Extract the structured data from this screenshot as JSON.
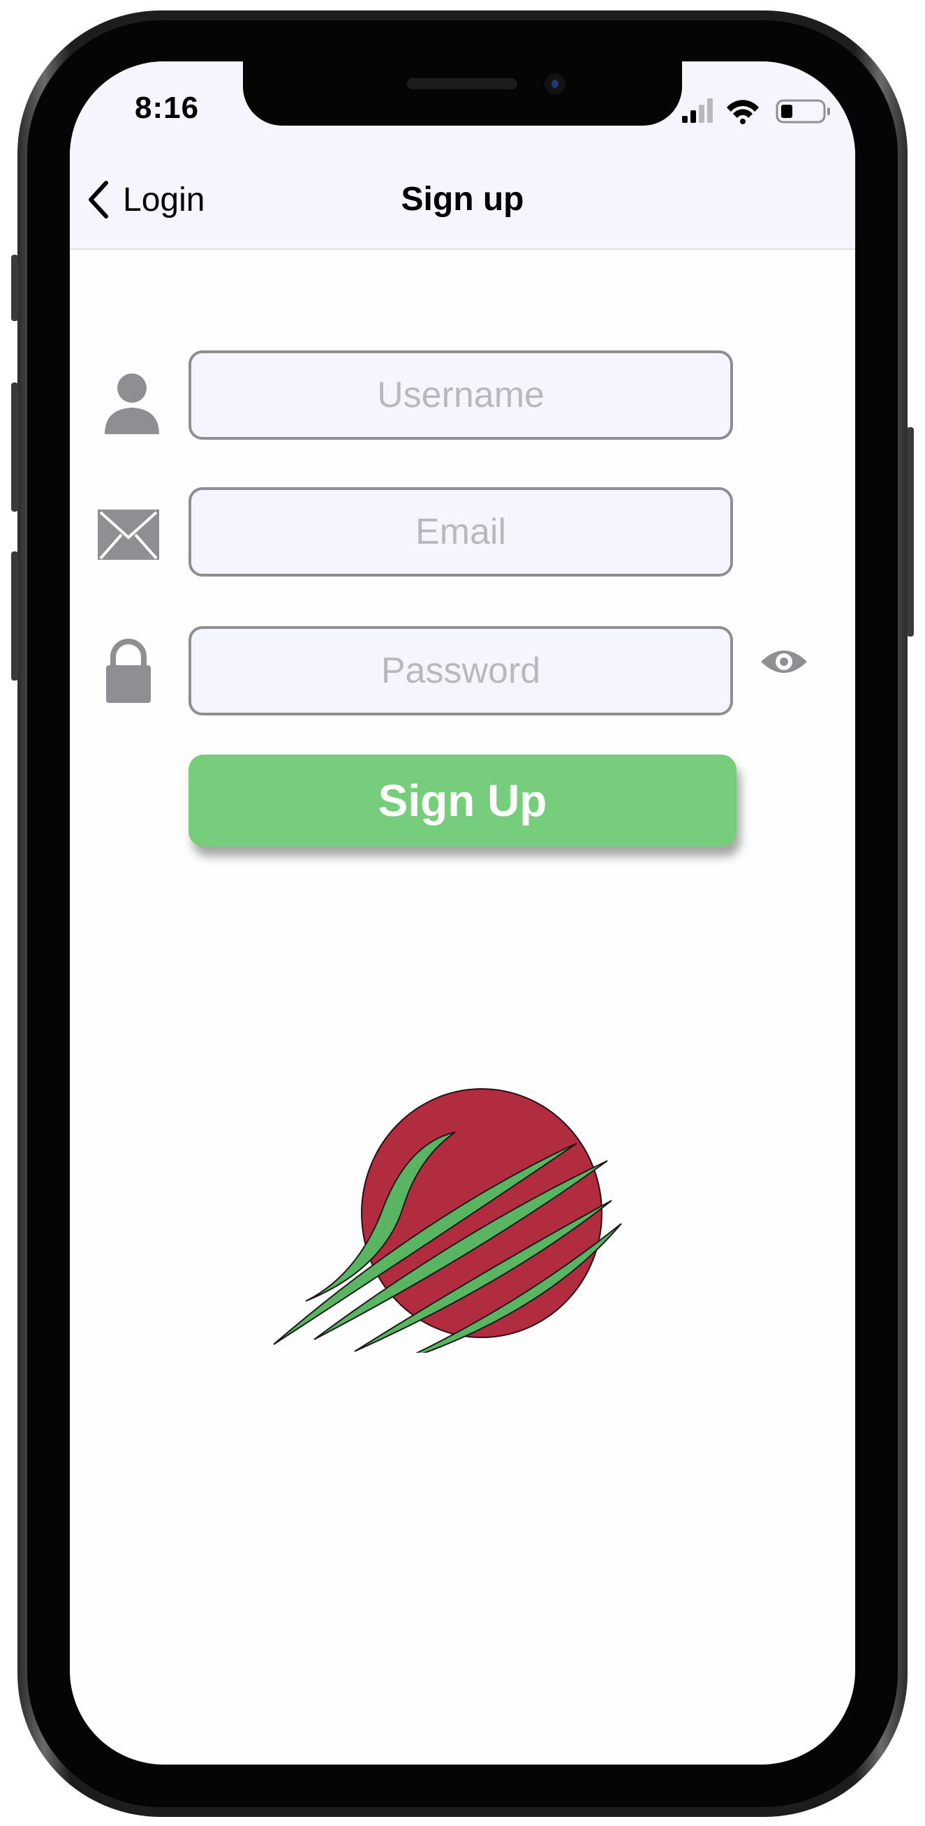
{
  "status_bar": {
    "time": "8:16"
  },
  "nav": {
    "back_label": "Login",
    "title": "Sign up"
  },
  "form": {
    "username": {
      "placeholder": "Username",
      "value": ""
    },
    "email": {
      "placeholder": "Email",
      "value": ""
    },
    "password": {
      "placeholder": "Password",
      "value": ""
    },
    "submit_label": "Sign Up"
  },
  "icons": {
    "back": "chevron-left-icon",
    "username": "person-icon",
    "email": "envelope-icon",
    "password": "lock-icon",
    "visibility": "eye-icon",
    "logo": "app-logo"
  },
  "colors": {
    "accent_green": "#76cd7c",
    "nav_background": "#f5f5fd",
    "field_border": "#8e8e93",
    "placeholder": "#b9b9bd",
    "logo_red": "#b22c40",
    "logo_green": "#5ab563"
  }
}
